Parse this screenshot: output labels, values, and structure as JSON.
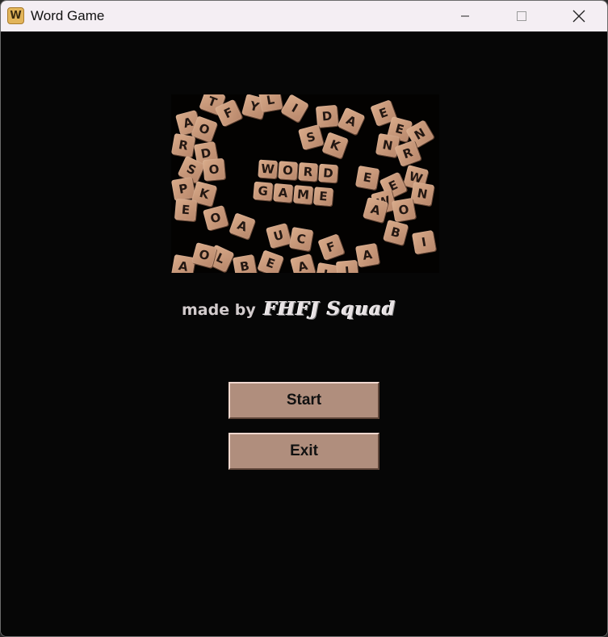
{
  "window": {
    "title": "Word Game",
    "app_icon_letter": "W",
    "controls": {
      "minimize": "minimize-icon",
      "maximize": "maximize-icon",
      "close": "close-icon"
    }
  },
  "banner": {
    "headline_words": [
      "WORD",
      "GAME"
    ],
    "tiles": [
      "T",
      "F",
      "Y",
      "L",
      "I",
      "A",
      "O",
      "D",
      "A",
      "E",
      "E",
      "N",
      "R",
      "D",
      "S",
      "K",
      "N",
      "R",
      "S",
      "O",
      "W",
      "E",
      "E",
      "P",
      "K",
      "N",
      "W",
      "E",
      "O",
      "A",
      "O",
      "A",
      "U",
      "C",
      "F",
      "B",
      "I",
      "L",
      "B",
      "E",
      "A",
      "L",
      "I",
      "A",
      "O",
      "A"
    ]
  },
  "credits": {
    "prefix": "made by",
    "team": "FHFJ Squad"
  },
  "menu": {
    "start_label": "Start",
    "exit_label": "Exit"
  },
  "colors": {
    "background": "#060606",
    "button": "#b08e7d",
    "tile": "#c99a7b",
    "titlebar": "#f4eef3"
  }
}
